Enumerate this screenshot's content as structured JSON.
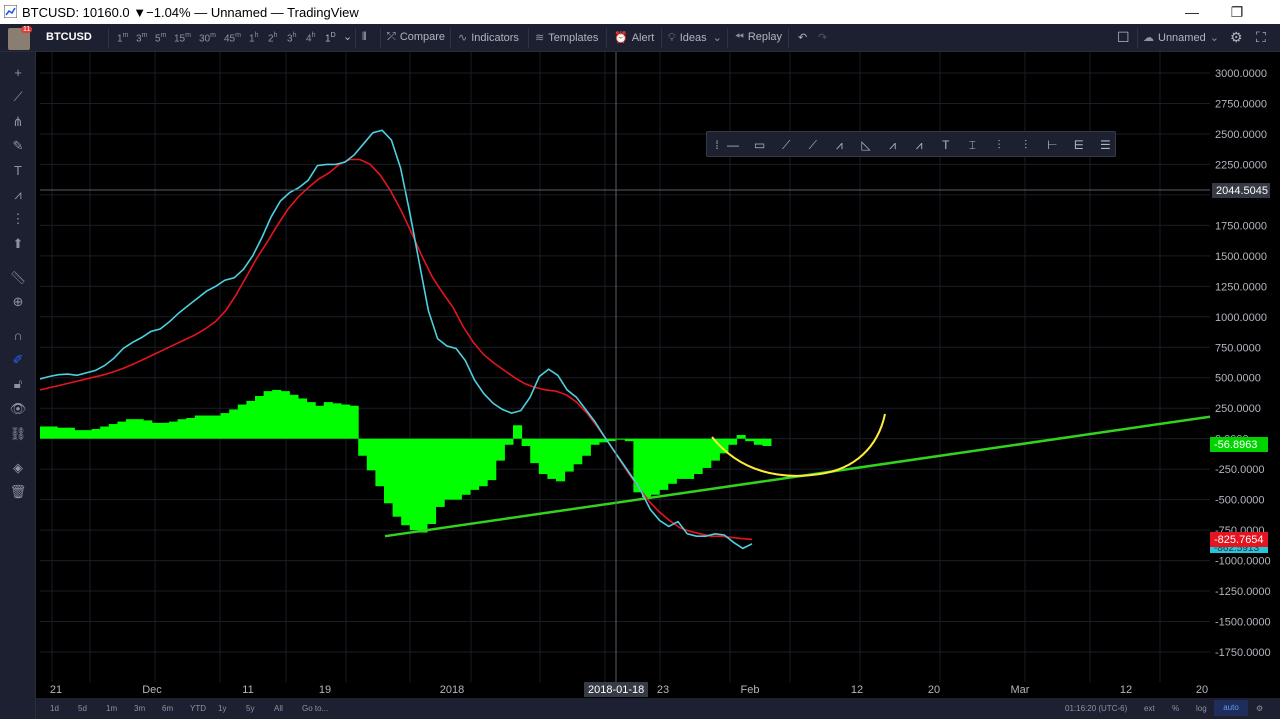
{
  "window": {
    "title": "BTCUSD: 10160.0 ▼−1.04% — Unnamed — TradingView",
    "minimize": "—",
    "restore": "❐"
  },
  "toolbar": {
    "avatar_badge": "11",
    "symbol": "BTCUSD",
    "intervals": [
      "1m",
      "3m",
      "5m",
      "15m",
      "30m",
      "45m",
      "1h",
      "2h",
      "3h",
      "4h",
      "1D"
    ],
    "intervals_display": [
      "1",
      "3",
      "5",
      "15",
      "30",
      "45",
      "1",
      "2",
      "3",
      "4",
      "1"
    ],
    "intervals_sup": [
      "m",
      "m",
      "m",
      "m",
      "m",
      "m",
      "h",
      "h",
      "h",
      "h",
      "D"
    ],
    "compare": "Compare",
    "indicators": "Indicators",
    "templates": "Templates",
    "alert": "Alert",
    "ideas": "Ideas",
    "replay": "Replay",
    "layout_name": "Unnamed"
  },
  "price_axis": {
    "ticks": [
      "3000.0000",
      "2750.0000",
      "2500.0000",
      "2250.0000",
      "2044.5045",
      "1750.0000",
      "1500.0000",
      "1250.0000",
      "1000.0000",
      "750.0000",
      "500.0000",
      "250.0000",
      "0.0000",
      "-250.0000",
      "-500.0000",
      "-750.0000",
      "-1000.0000",
      "-1250.0000",
      "-1500.0000",
      "-1750.0000"
    ],
    "crosshair_label": "2044.5045",
    "hist_label": "-56.8963",
    "signal_label": "-825.7654",
    "macd_label": "-862.5913"
  },
  "time_axis": {
    "ticks": [
      "21",
      "Dec",
      "11",
      "19",
      "2018",
      "23",
      "Feb",
      "12",
      "20",
      "Mar",
      "12",
      "20"
    ],
    "crosshair_label": "2018-01-18"
  },
  "bottombar": {
    "ranges": [
      "1d",
      "5d",
      "1m",
      "3m",
      "6m",
      "YTD",
      "1y",
      "5y",
      "All",
      "Go to..."
    ],
    "clock": "01:16:20 (UTC-6)",
    "ext": "ext",
    "pct": "%",
    "log": "log",
    "auto": "auto"
  },
  "colors": {
    "macd_line": "#4dd0e1",
    "signal_line": "#e5141f",
    "histogram": "#00ff00",
    "trend_line": "#32d21e",
    "annotation_curve": "#ffeb3b",
    "background": "#000000"
  },
  "chart_data": {
    "type": "line",
    "series": [
      {
        "values": [
          490,
          510,
          525,
          530,
          520,
          540,
          560,
          600,
          660,
          740,
          790,
          830,
          880,
          900,
          960,
          1030,
          1090,
          1150,
          1210,
          1250,
          1300,
          1320,
          1390,
          1500,
          1650,
          1820,
          1950,
          2020,
          2060,
          2120,
          2240,
          2250,
          2250,
          2270,
          2330,
          2420,
          2510,
          2530,
          2450,
          2220,
          1850,
          1450,
          1050,
          820,
          760,
          740,
          640,
          480,
          370,
          290,
          240,
          210,
          230,
          340,
          510,
          570,
          520,
          400,
          340,
          240,
          140,
          20,
          -90,
          -200,
          -310,
          -430,
          -580,
          -670,
          -720,
          -680,
          -780,
          -800,
          -800,
          -780,
          -790,
          -850,
          -900,
          -862
        ]
      },
      {
        "values": [
          400,
          420,
          440,
          460,
          480,
          500,
          520,
          545,
          575,
          610,
          650,
          690,
          730,
          770,
          810,
          850,
          900,
          960,
          1050,
          1180,
          1330,
          1480,
          1610,
          1750,
          1880,
          1980,
          2060,
          2130,
          2180,
          2250,
          2290,
          2290,
          2250,
          2160,
          2030,
          1870,
          1690,
          1500,
          1330,
          1200,
          1080,
          920,
          790,
          690,
          620,
          560,
          500,
          450,
          420,
          400,
          390,
          360,
          300,
          210,
          100,
          -20,
          -150,
          -280,
          -400,
          -510,
          -600,
          -670,
          -730,
          -760,
          -780,
          -800,
          -800,
          -810,
          -820,
          -826
        ]
      }
    ],
    "histogram": [
      100,
      100,
      90,
      90,
      70,
      70,
      80,
      100,
      120,
      140,
      160,
      160,
      150,
      130,
      130,
      140,
      160,
      170,
      190,
      190,
      190,
      210,
      240,
      280,
      310,
      350,
      390,
      400,
      390,
      360,
      330,
      300,
      270,
      300,
      290,
      280,
      270,
      -140,
      -260,
      -390,
      -530,
      -640,
      -710,
      -750,
      -770,
      -700,
      -560,
      -500,
      -500,
      -460,
      -420,
      -390,
      -340,
      -180,
      -50,
      110,
      -60,
      -200,
      -290,
      -330,
      -350,
      -270,
      -210,
      -140,
      -50,
      -30,
      -20,
      0,
      -20,
      -440,
      -480,
      -460,
      -420,
      -370,
      -330,
      -330,
      -290,
      -240,
      -180,
      -120,
      -50,
      30,
      -20,
      -50,
      -60
    ],
    "trend_line": {
      "from": [
        0,
        -800
      ],
      "to": [
        1,
        180
      ]
    },
    "ylim": [
      -1900,
      3050
    ],
    "grid": true
  }
}
